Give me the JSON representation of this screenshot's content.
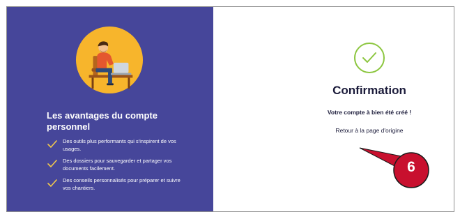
{
  "left": {
    "title": "Les avantages du compte personnel",
    "benefits": [
      "Des outils plus performants qui s'inspirent de vos usages.",
      "Des dossiers pour sauvegarder et partager vos documents facilement.",
      "Des conseils personnalisés pour préparer et suivre vos chantiers."
    ]
  },
  "right": {
    "title": "Confirmation",
    "message": "Votre compte à bien été créé !",
    "link": "Retour à la page d'origine"
  },
  "annotation": {
    "step": "6"
  },
  "colors": {
    "panel": "#46469a",
    "check": "#f2c94c",
    "success": "#8cc63f",
    "callout": "#c8102e"
  },
  "icons": [
    "person-laptop-illustration",
    "check-icon",
    "success-check-icon",
    "callout-arrow-icon"
  ]
}
